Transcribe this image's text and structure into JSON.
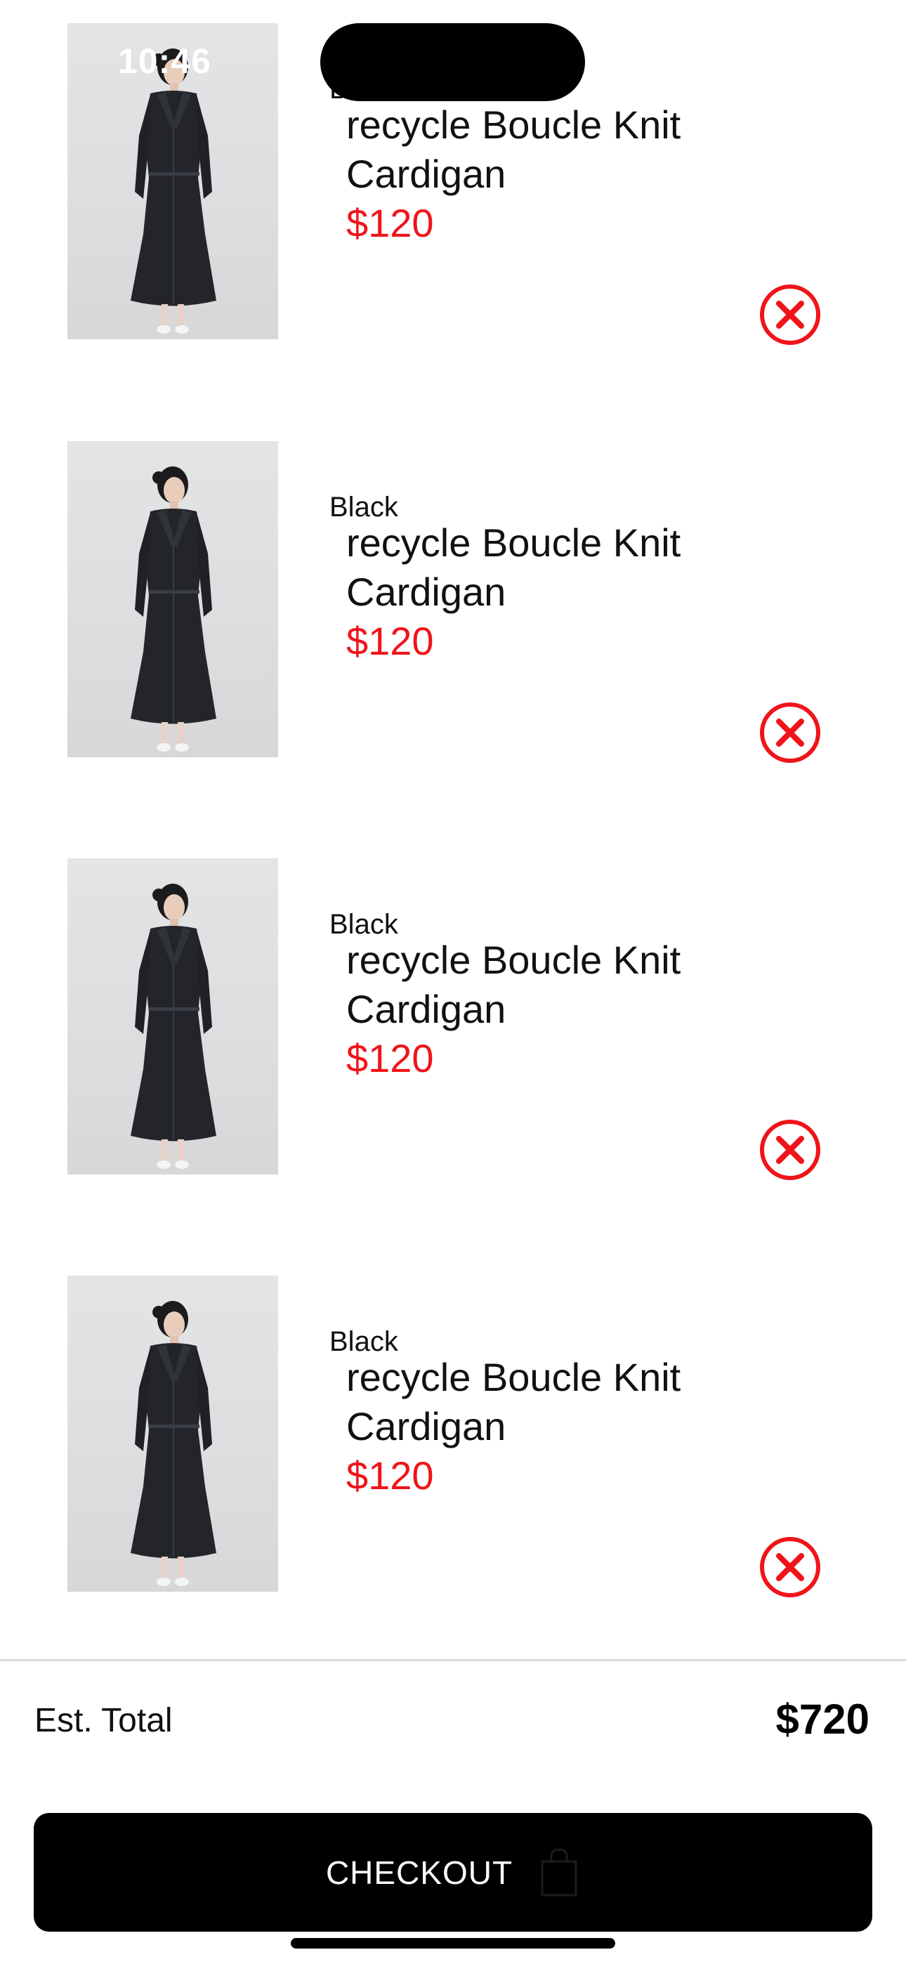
{
  "status_bar": {
    "time": "10:46"
  },
  "cart": {
    "items": [
      {
        "color": "Black",
        "name": "recycle Boucle Knit Cardigan",
        "price": "$120"
      },
      {
        "color": "Black",
        "name": "recycle Boucle Knit Cardigan",
        "price": "$120"
      },
      {
        "color": "Black",
        "name": "recycle Boucle Knit Cardigan",
        "price": "$120"
      },
      {
        "color": "Black",
        "name": "recycle Boucle Knit Cardigan",
        "price": "$120"
      }
    ],
    "remove_icon": "close-circle-icon",
    "price_color": "#f0141a"
  },
  "summary": {
    "label": "Est. Total",
    "total": "$720"
  },
  "checkout": {
    "label": "CHECKOUT",
    "icon": "shopping-bag-icon"
  }
}
